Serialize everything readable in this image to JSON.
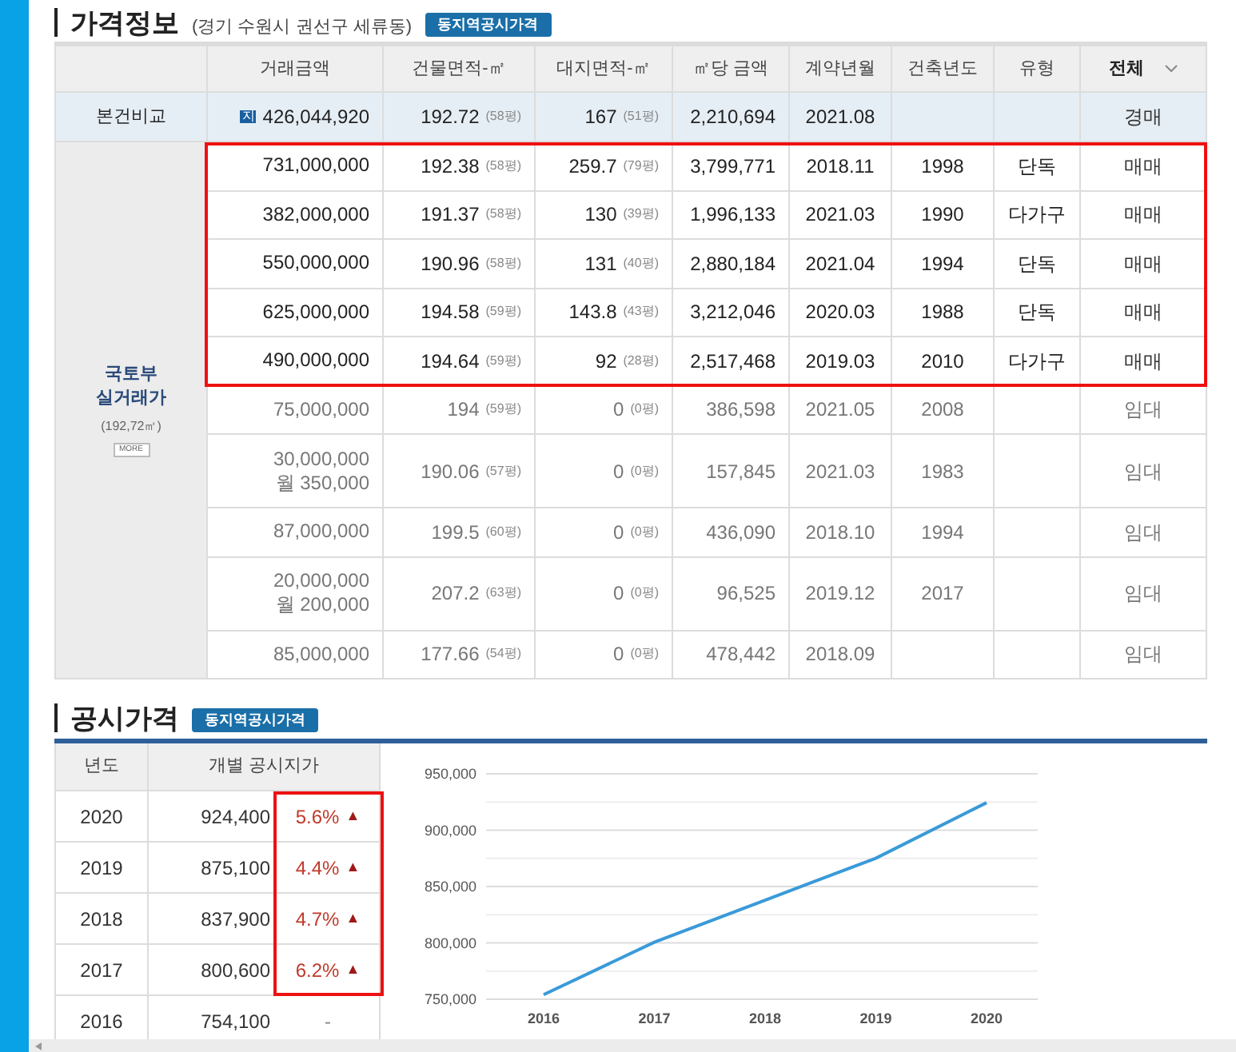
{
  "price_info": {
    "title": "가격정보",
    "location": "(경기 수원시 권선구 세류동)",
    "badge": "동지역공시가격",
    "columns": [
      "거래금액",
      "건물면적-㎡",
      "대지면적-㎡",
      "㎡당 금액",
      "계약년월",
      "건축년도",
      "유형"
    ],
    "filter": {
      "label": "전체",
      "kind": "dropdown"
    },
    "subject": {
      "label": "본건비교",
      "mark": "지",
      "price": [
        "426,044,920"
      ],
      "building": "192.72",
      "building_py": "(58평)",
      "land": "167",
      "land_py": "(51평)",
      "per_m2": "2,210,694",
      "date": "2021.08",
      "deal": "경매"
    },
    "real_trades": {
      "label": [
        "국토부",
        "실거래가"
      ],
      "area": "(192,72㎡)",
      "more": "MORE",
      "rows": [
        {
          "kind": "sale",
          "highlighted": true,
          "price": [
            "731,000,000"
          ],
          "building": "192.38",
          "building_py": "(58평)",
          "land": "259.7",
          "land_py": "(79평)",
          "per_m2": "3,799,771",
          "date": "2018.11",
          "year": "1998",
          "type": "단독",
          "deal": "매매"
        },
        {
          "kind": "sale",
          "highlighted": true,
          "price": [
            "382,000,000"
          ],
          "building": "191.37",
          "building_py": "(58평)",
          "land": "130",
          "land_py": "(39평)",
          "per_m2": "1,996,133",
          "date": "2021.03",
          "year": "1990",
          "type": "다가구",
          "deal": "매매"
        },
        {
          "kind": "sale",
          "highlighted": true,
          "price": [
            "550,000,000"
          ],
          "building": "190.96",
          "building_py": "(58평)",
          "land": "131",
          "land_py": "(40평)",
          "per_m2": "2,880,184",
          "date": "2021.04",
          "year": "1994",
          "type": "단독",
          "deal": "매매"
        },
        {
          "kind": "sale",
          "highlighted": true,
          "price": [
            "625,000,000"
          ],
          "building": "194.58",
          "building_py": "(59평)",
          "land": "143.8",
          "land_py": "(43평)",
          "per_m2": "3,212,046",
          "date": "2020.03",
          "year": "1988",
          "type": "단독",
          "deal": "매매"
        },
        {
          "kind": "sale",
          "highlighted": true,
          "price": [
            "490,000,000"
          ],
          "building": "194.64",
          "building_py": "(59평)",
          "land": "92",
          "land_py": "(28평)",
          "per_m2": "2,517,468",
          "date": "2019.03",
          "year": "2010",
          "type": "다가구",
          "deal": "매매"
        },
        {
          "kind": "rent",
          "highlighted": false,
          "price": [
            "75,000,000"
          ],
          "building": "194",
          "building_py": "(59평)",
          "land": "0",
          "land_py": "(0평)",
          "per_m2": "386,598",
          "date": "2021.05",
          "year": "2008",
          "deal": "임대"
        },
        {
          "kind": "rent",
          "highlighted": false,
          "price": [
            "30,000,000",
            "월 350,000"
          ],
          "building": "190.06",
          "building_py": "(57평)",
          "land": "0",
          "land_py": "(0평)",
          "per_m2": "157,845",
          "date": "2021.03",
          "year": "1983",
          "deal": "임대"
        },
        {
          "kind": "rent",
          "highlighted": false,
          "price": [
            "87,000,000"
          ],
          "building": "199.5",
          "building_py": "(60평)",
          "land": "0",
          "land_py": "(0평)",
          "per_m2": "436,090",
          "date": "2018.10",
          "year": "1994",
          "deal": "임대"
        },
        {
          "kind": "rent",
          "highlighted": false,
          "price": [
            "20,000,000",
            "월 200,000"
          ],
          "building": "207.2",
          "building_py": "(63평)",
          "land": "0",
          "land_py": "(0평)",
          "per_m2": "96,525",
          "date": "2019.12",
          "year": "2017",
          "deal": "임대"
        },
        {
          "kind": "rent",
          "highlighted": false,
          "price": [
            "85,000,000"
          ],
          "building": "177.66",
          "building_py": "(54평)",
          "land": "0",
          "land_py": "(0평)",
          "per_m2": "478,442",
          "date": "2018.09",
          "deal": "임대"
        }
      ]
    }
  },
  "official_price": {
    "title": "공시가격",
    "badge": "동지역공시가격",
    "columns": [
      "년도",
      "개별 공시지가"
    ],
    "rows": [
      {
        "year": "2020",
        "price": "924,400",
        "change": "5.6%",
        "arrow": "▲",
        "highlighted": true
      },
      {
        "year": "2019",
        "price": "875,100",
        "change": "4.4%",
        "arrow": "▲",
        "highlighted": true
      },
      {
        "year": "2018",
        "price": "837,900",
        "change": "4.7%",
        "arrow": "▲",
        "highlighted": true
      },
      {
        "year": "2017",
        "price": "800,600",
        "change": "6.2%",
        "arrow": "▲",
        "highlighted": true
      },
      {
        "year": "2016",
        "price": "754,100",
        "change": "-",
        "highlighted": false
      }
    ],
    "chart_data": {
      "type": "line",
      "categories": [
        "2016",
        "2017",
        "2018",
        "2019",
        "2020"
      ],
      "series": [
        {
          "color": "#3a9ad9",
          "values": [
            754100,
            800600,
            837900,
            875100,
            924400
          ]
        }
      ],
      "ylim": [
        750000,
        950000
      ],
      "grid": true,
      "yticks": [
        {
          "value": 750000,
          "label": "750,000"
        },
        {
          "value": 800000,
          "label": "800,000"
        },
        {
          "value": 850000,
          "label": "850,000"
        },
        {
          "value": 900000,
          "label": "900,000"
        },
        {
          "value": 950000,
          "label": "950,000"
        }
      ]
    }
  }
}
